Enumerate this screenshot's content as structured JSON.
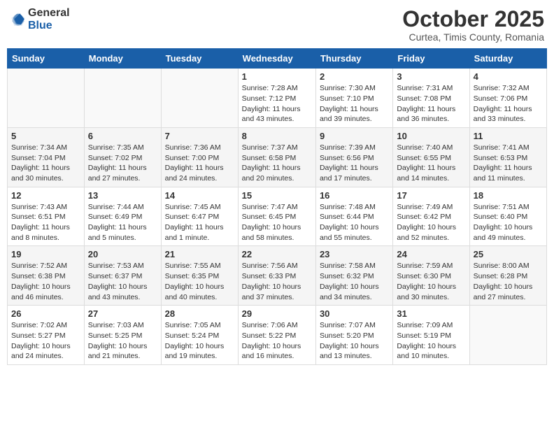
{
  "logo": {
    "general": "General",
    "blue": "Blue"
  },
  "title": "October 2025",
  "location": "Curtea, Timis County, Romania",
  "headers": [
    "Sunday",
    "Monday",
    "Tuesday",
    "Wednesday",
    "Thursday",
    "Friday",
    "Saturday"
  ],
  "weeks": [
    [
      {
        "day": "",
        "info": ""
      },
      {
        "day": "",
        "info": ""
      },
      {
        "day": "",
        "info": ""
      },
      {
        "day": "1",
        "info": "Sunrise: 7:28 AM\nSunset: 7:12 PM\nDaylight: 11 hours and 43 minutes."
      },
      {
        "day": "2",
        "info": "Sunrise: 7:30 AM\nSunset: 7:10 PM\nDaylight: 11 hours and 39 minutes."
      },
      {
        "day": "3",
        "info": "Sunrise: 7:31 AM\nSunset: 7:08 PM\nDaylight: 11 hours and 36 minutes."
      },
      {
        "day": "4",
        "info": "Sunrise: 7:32 AM\nSunset: 7:06 PM\nDaylight: 11 hours and 33 minutes."
      }
    ],
    [
      {
        "day": "5",
        "info": "Sunrise: 7:34 AM\nSunset: 7:04 PM\nDaylight: 11 hours and 30 minutes."
      },
      {
        "day": "6",
        "info": "Sunrise: 7:35 AM\nSunset: 7:02 PM\nDaylight: 11 hours and 27 minutes."
      },
      {
        "day": "7",
        "info": "Sunrise: 7:36 AM\nSunset: 7:00 PM\nDaylight: 11 hours and 24 minutes."
      },
      {
        "day": "8",
        "info": "Sunrise: 7:37 AM\nSunset: 6:58 PM\nDaylight: 11 hours and 20 minutes."
      },
      {
        "day": "9",
        "info": "Sunrise: 7:39 AM\nSunset: 6:56 PM\nDaylight: 11 hours and 17 minutes."
      },
      {
        "day": "10",
        "info": "Sunrise: 7:40 AM\nSunset: 6:55 PM\nDaylight: 11 hours and 14 minutes."
      },
      {
        "day": "11",
        "info": "Sunrise: 7:41 AM\nSunset: 6:53 PM\nDaylight: 11 hours and 11 minutes."
      }
    ],
    [
      {
        "day": "12",
        "info": "Sunrise: 7:43 AM\nSunset: 6:51 PM\nDaylight: 11 hours and 8 minutes."
      },
      {
        "day": "13",
        "info": "Sunrise: 7:44 AM\nSunset: 6:49 PM\nDaylight: 11 hours and 5 minutes."
      },
      {
        "day": "14",
        "info": "Sunrise: 7:45 AM\nSunset: 6:47 PM\nDaylight: 11 hours and 1 minute."
      },
      {
        "day": "15",
        "info": "Sunrise: 7:47 AM\nSunset: 6:45 PM\nDaylight: 10 hours and 58 minutes."
      },
      {
        "day": "16",
        "info": "Sunrise: 7:48 AM\nSunset: 6:44 PM\nDaylight: 10 hours and 55 minutes."
      },
      {
        "day": "17",
        "info": "Sunrise: 7:49 AM\nSunset: 6:42 PM\nDaylight: 10 hours and 52 minutes."
      },
      {
        "day": "18",
        "info": "Sunrise: 7:51 AM\nSunset: 6:40 PM\nDaylight: 10 hours and 49 minutes."
      }
    ],
    [
      {
        "day": "19",
        "info": "Sunrise: 7:52 AM\nSunset: 6:38 PM\nDaylight: 10 hours and 46 minutes."
      },
      {
        "day": "20",
        "info": "Sunrise: 7:53 AM\nSunset: 6:37 PM\nDaylight: 10 hours and 43 minutes."
      },
      {
        "day": "21",
        "info": "Sunrise: 7:55 AM\nSunset: 6:35 PM\nDaylight: 10 hours and 40 minutes."
      },
      {
        "day": "22",
        "info": "Sunrise: 7:56 AM\nSunset: 6:33 PM\nDaylight: 10 hours and 37 minutes."
      },
      {
        "day": "23",
        "info": "Sunrise: 7:58 AM\nSunset: 6:32 PM\nDaylight: 10 hours and 34 minutes."
      },
      {
        "day": "24",
        "info": "Sunrise: 7:59 AM\nSunset: 6:30 PM\nDaylight: 10 hours and 30 minutes."
      },
      {
        "day": "25",
        "info": "Sunrise: 8:00 AM\nSunset: 6:28 PM\nDaylight: 10 hours and 27 minutes."
      }
    ],
    [
      {
        "day": "26",
        "info": "Sunrise: 7:02 AM\nSunset: 5:27 PM\nDaylight: 10 hours and 24 minutes."
      },
      {
        "day": "27",
        "info": "Sunrise: 7:03 AM\nSunset: 5:25 PM\nDaylight: 10 hours and 21 minutes."
      },
      {
        "day": "28",
        "info": "Sunrise: 7:05 AM\nSunset: 5:24 PM\nDaylight: 10 hours and 19 minutes."
      },
      {
        "day": "29",
        "info": "Sunrise: 7:06 AM\nSunset: 5:22 PM\nDaylight: 10 hours and 16 minutes."
      },
      {
        "day": "30",
        "info": "Sunrise: 7:07 AM\nSunset: 5:20 PM\nDaylight: 10 hours and 13 minutes."
      },
      {
        "day": "31",
        "info": "Sunrise: 7:09 AM\nSunset: 5:19 PM\nDaylight: 10 hours and 10 minutes."
      },
      {
        "day": "",
        "info": ""
      }
    ]
  ]
}
